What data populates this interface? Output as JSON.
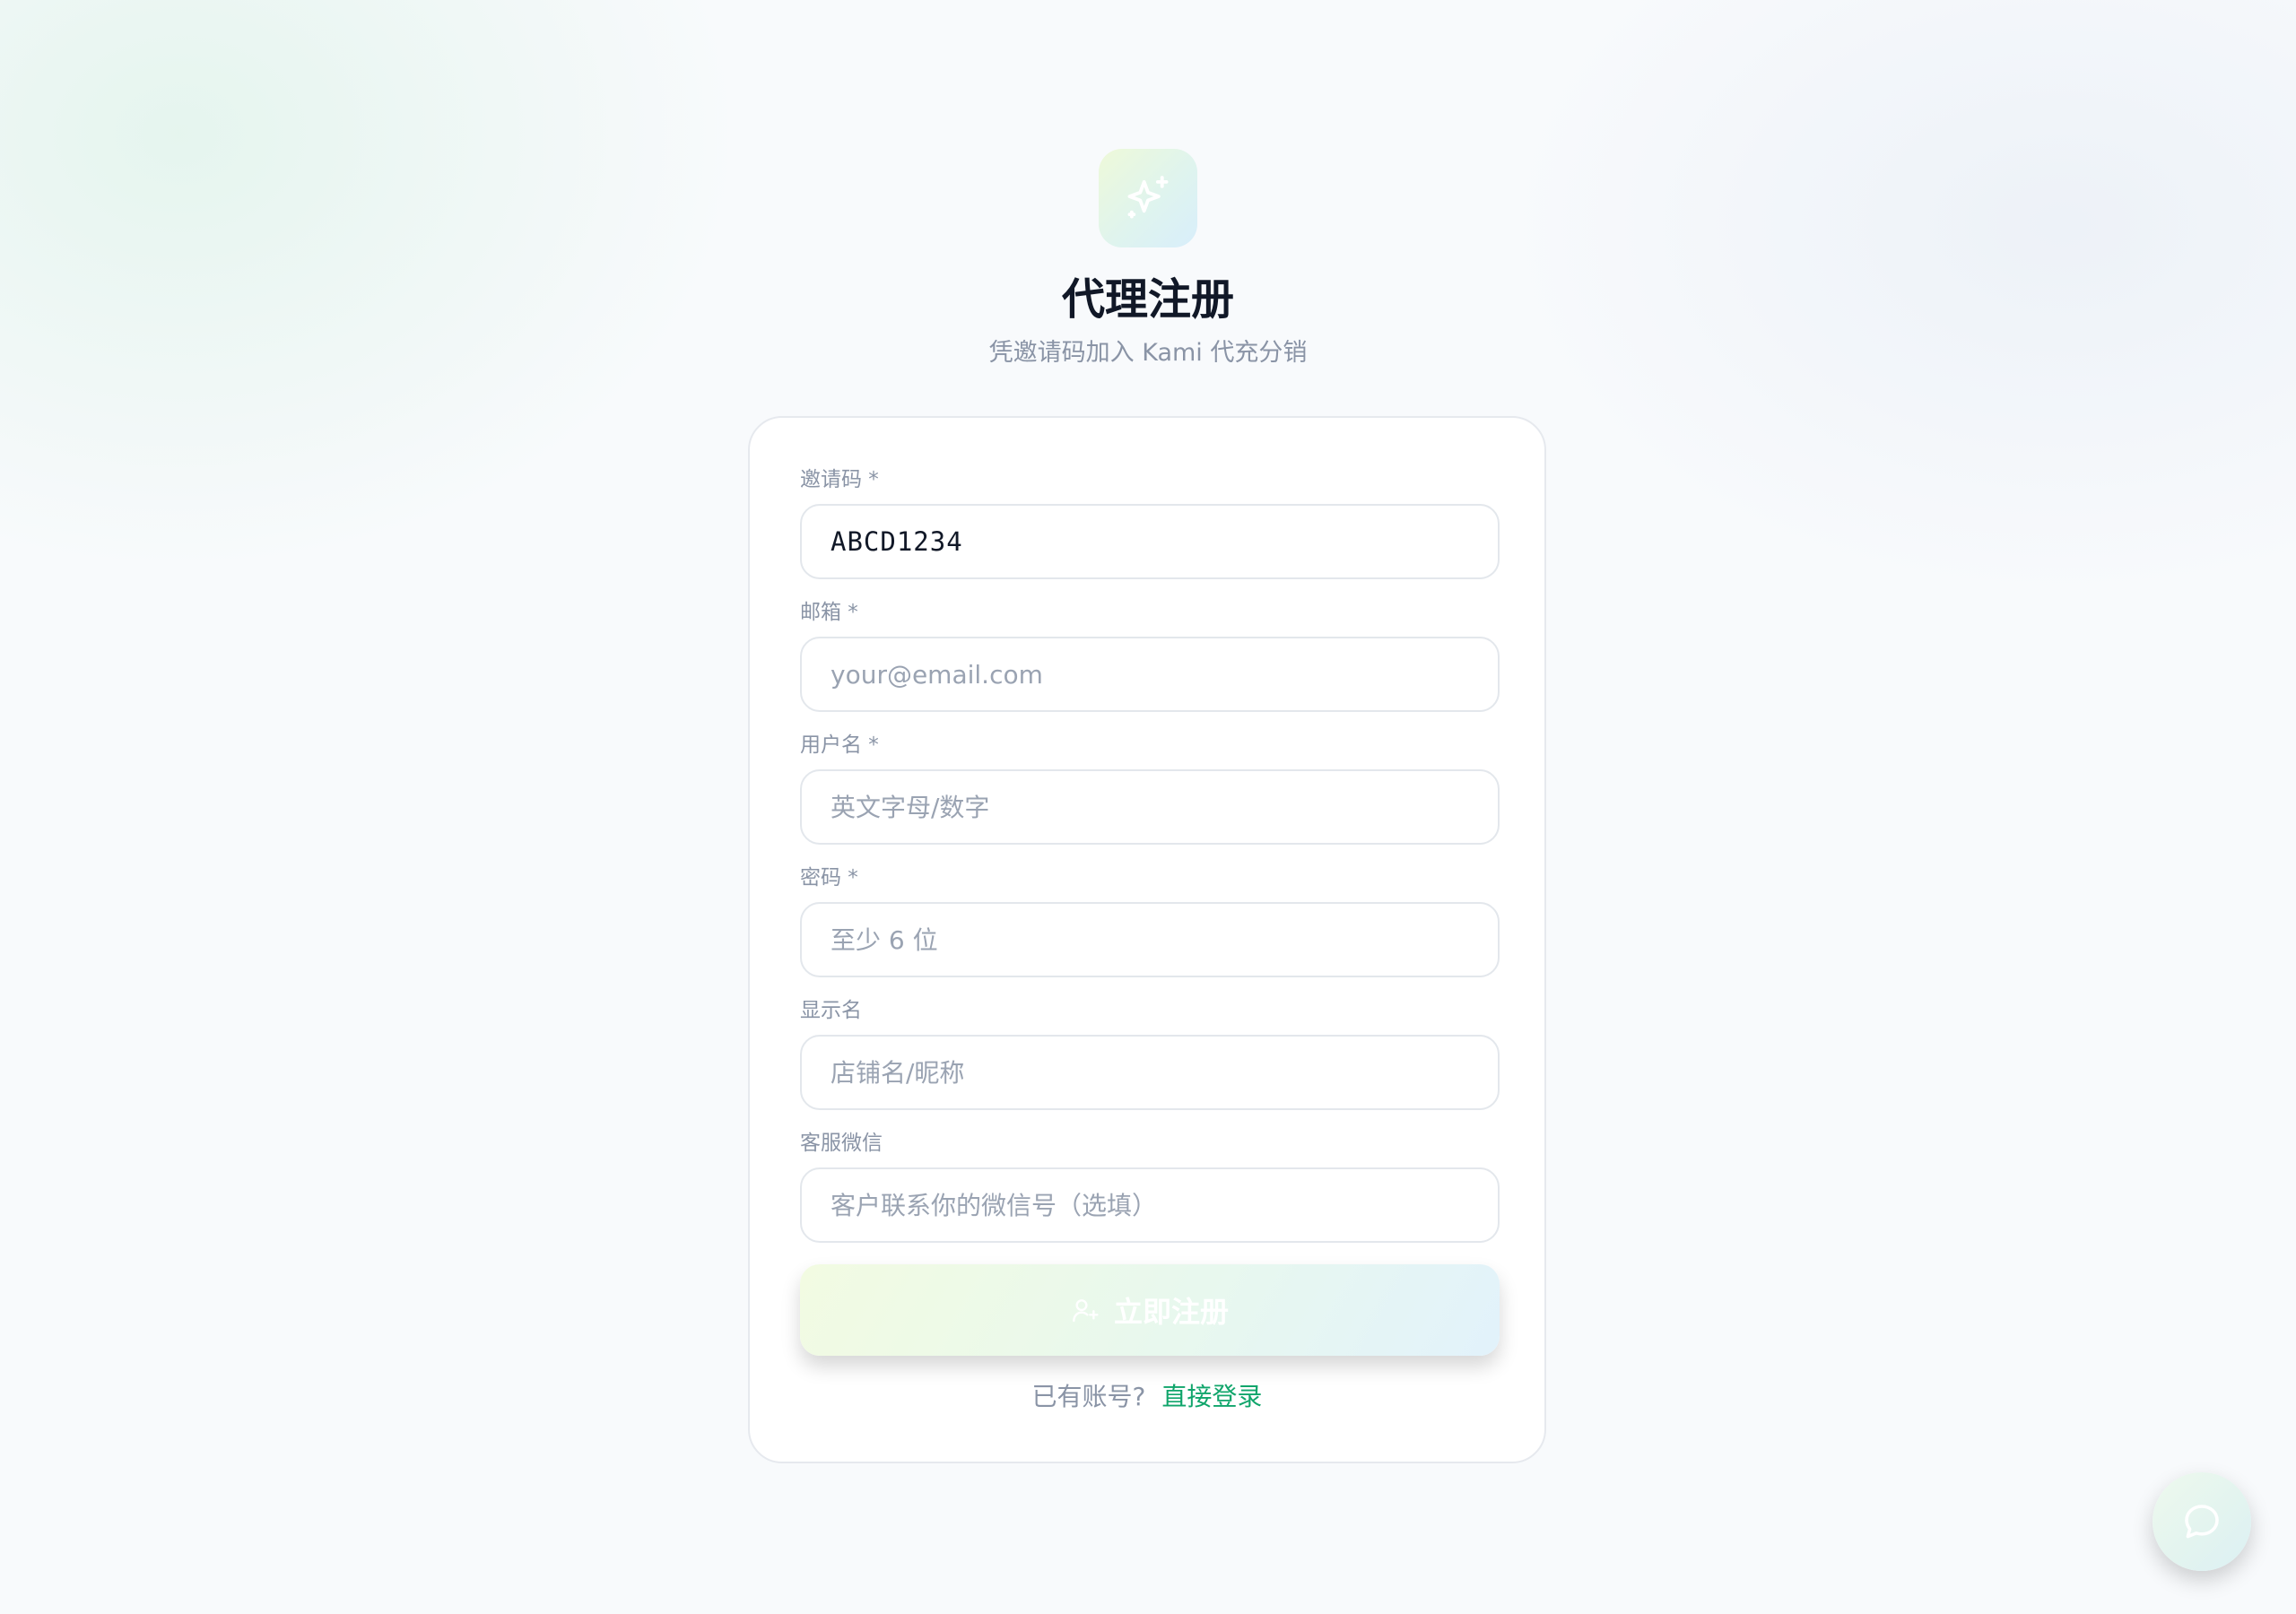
{
  "header": {
    "logo_icon": "sparkles-icon",
    "title": "代理注册",
    "subtitle": "凭邀请码加入 Kami 代充分销"
  },
  "form": {
    "invite_code": {
      "label": "邀请码 *",
      "value": "ABCD1234"
    },
    "email": {
      "label": "邮箱 *",
      "placeholder": "your@email.com"
    },
    "username": {
      "label": "用户名 *",
      "placeholder": "英文字母/数字"
    },
    "password": {
      "label": "密码 *",
      "placeholder": "至少 6 位"
    },
    "display_name": {
      "label": "显示名",
      "placeholder": "店铺名/昵称"
    },
    "wechat": {
      "label": "客服微信",
      "placeholder": "客户联系你的微信号（选填）"
    },
    "submit": {
      "icon": "user-plus-icon",
      "label": "立即注册"
    },
    "footer": {
      "prompt": "已有账号?",
      "login_link": "直接登录"
    }
  },
  "chat_fab": {
    "icon": "chat-bubble-icon"
  },
  "colors": {
    "accent": "#10a56b",
    "title": "#111827",
    "muted": "#8a94a6",
    "border": "#e3e7ec",
    "background": "#f8fafc"
  }
}
